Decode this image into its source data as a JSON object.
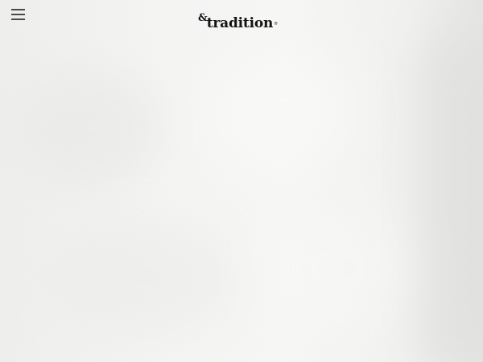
{
  "header": {
    "menu_icon": "hamburger-menu-icon",
    "logo": {
      "ampersand": "&",
      "wordmark": "tradition",
      "registered": "®",
      "color": "#141414"
    }
  },
  "hero": {
    "background_color": "#f3f3f2"
  }
}
